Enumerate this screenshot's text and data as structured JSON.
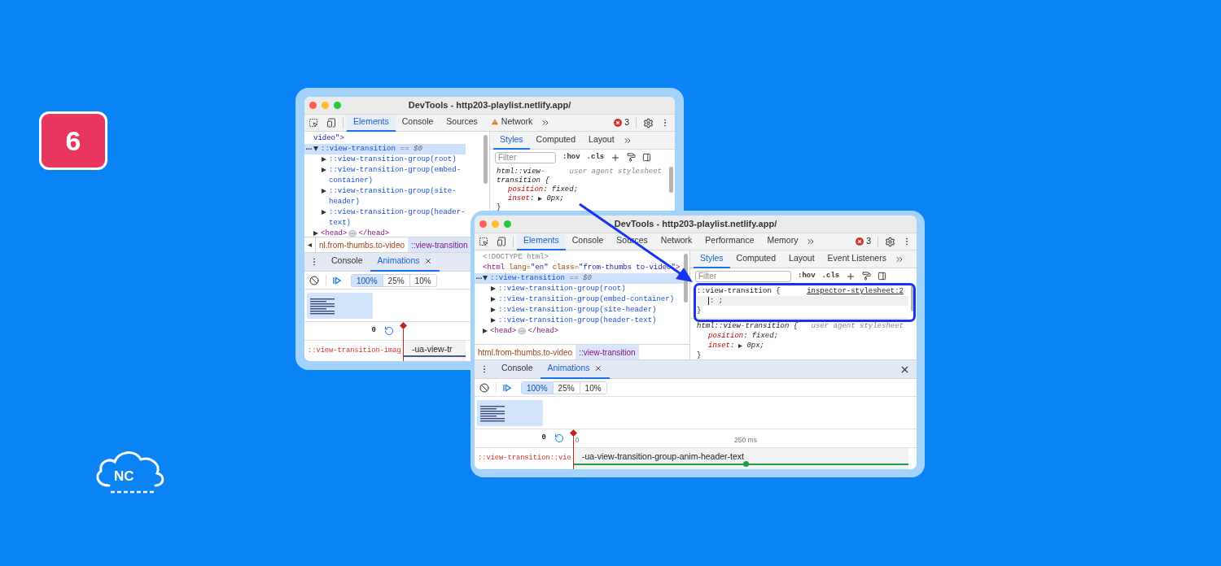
{
  "slide_badge": "6",
  "logo_text": "NC",
  "windows": [
    {
      "title": "DevTools - http203-playlist.netlify.app/",
      "toolbar_tabs": [
        {
          "label": "Elements",
          "selected": true,
          "warning": false
        },
        {
          "label": "Console",
          "selected": false,
          "warning": false
        },
        {
          "label": "Sources",
          "selected": false,
          "warning": false
        },
        {
          "label": "Network",
          "selected": false,
          "warning": true
        }
      ],
      "error_count": "3",
      "dom_tree": [
        {
          "parts": [
            {
              "kind": "value",
              "text": "video\""
            },
            {
              "kind": "tag",
              "text": ">"
            }
          ],
          "selected": false,
          "children": [
            {
              "parts": [
                {
                  "kind": "pseudo",
                  "text": "::view-transition"
                },
                {
                  "kind": "hint",
                  "text": "== $0"
                }
              ],
              "selected": true,
              "expanded": true,
              "children": [
                {
                  "parts": [
                    {
                      "kind": "pseudo",
                      "text": "::view-transition-group(root)"
                    }
                  ],
                  "selected": false,
                  "expanded": false
                },
                {
                  "parts": [
                    {
                      "kind": "pseudo",
                      "text": "::view-transition-group(embed-container)"
                    }
                  ],
                  "selected": false,
                  "expanded": false
                },
                {
                  "parts": [
                    {
                      "kind": "pseudo",
                      "text": "::view-transition-group(site-header)"
                    }
                  ],
                  "selected": false,
                  "expanded": false
                },
                {
                  "parts": [
                    {
                      "kind": "pseudo",
                      "text": "::view-transition-group(header-text)"
                    }
                  ],
                  "selected": false,
                  "expanded": false
                }
              ]
            },
            {
              "parts": [
                {
                  "kind": "tag",
                  "text": "<head>"
                },
                {
                  "kind": "collapsed"
                },
                {
                  "kind": "tag",
                  "text": "</head>"
                }
              ],
              "selected": false,
              "expanded": false
            }
          ]
        }
      ],
      "breadcrumbs": {
        "scroll_left": true,
        "items": [
          {
            "text": "nl.from-thumbs.to-video",
            "selected": false
          },
          {
            "text": "::view-transition",
            "selected": true
          }
        ]
      },
      "styles_tabs": [
        {
          "label": "Styles",
          "selected": true
        },
        {
          "label": "Computed",
          "selected": false
        },
        {
          "label": "Layout",
          "selected": false
        }
      ],
      "filter_placeholder": "Filter",
      "style_buttons": [
        ":hov",
        ".cls"
      ],
      "style_rules": [
        {
          "selector": "html::view-transition {",
          "source": "user agent stylesheet",
          "kind": "ua",
          "declarations": [
            {
              "kind": "declaration",
              "property": "position",
              "colon": ":",
              "value": "fixed;",
              "expandable": false
            },
            {
              "kind": "declaration",
              "property": "inset",
              "colon": ":",
              "value": "0px;",
              "expandable": true
            }
          ],
          "close": "}"
        }
      ],
      "drawer_tabs": [
        {
          "label": "Console",
          "selected": false,
          "closable": false
        },
        {
          "label": "Animations",
          "selected": true,
          "closable": true
        }
      ],
      "drawer_close": false,
      "speeds": [
        {
          "label": "100%",
          "selected": true
        },
        {
          "label": "25%",
          "selected": false
        },
        {
          "label": "10%",
          "selected": false
        }
      ],
      "previews": [
        {
          "selected": true
        }
      ],
      "current_time": "0",
      "animations": [
        {
          "name": "::view-transition-imag",
          "label": "-ua-view-tr",
          "color": "#4b5c86"
        }
      ]
    },
    {
      "title": "DevTools - http203-playlist.netlify.app/",
      "toolbar_tabs": [
        {
          "label": "Elements",
          "selected": true,
          "warning": false
        },
        {
          "label": "Console",
          "selected": false,
          "warning": false
        },
        {
          "label": "Sources",
          "selected": false,
          "warning": false
        },
        {
          "label": "Network",
          "selected": false,
          "warning": false
        },
        {
          "label": "Performance",
          "selected": false,
          "warning": false
        },
        {
          "label": "Memory",
          "selected": false,
          "warning": false
        }
      ],
      "error_count": "3",
      "dom_tree": [
        {
          "parts": [
            {
              "kind": "doctype",
              "text": "<!DOCTYPE html>"
            }
          ],
          "selected": false
        },
        {
          "parts": [
            {
              "kind": "tag",
              "text": "<html"
            },
            {
              "kind": "attr",
              "text": "lang="
            },
            {
              "kind": "value",
              "text": "\"en\""
            },
            {
              "kind": "attr",
              "text": "class="
            },
            {
              "kind": "value",
              "text": "\"from-thumbs to-video\""
            },
            {
              "kind": "tag",
              "text": ">"
            }
          ],
          "selected": false,
          "children": [
            {
              "parts": [
                {
                  "kind": "pseudo",
                  "text": "::view-transition"
                },
                {
                  "kind": "hint",
                  "text": "== $0"
                }
              ],
              "selected": true,
              "expanded": true,
              "children": [
                {
                  "parts": [
                    {
                      "kind": "pseudo",
                      "text": "::view-transition-group(root)"
                    }
                  ],
                  "selected": false,
                  "expanded": false
                },
                {
                  "parts": [
                    {
                      "kind": "pseudo",
                      "text": "::view-transition-group(embed-container)"
                    }
                  ],
                  "selected": false,
                  "expanded": false
                },
                {
                  "parts": [
                    {
                      "kind": "pseudo",
                      "text": "::view-transition-group(site-header)"
                    }
                  ],
                  "selected": false,
                  "expanded": false
                },
                {
                  "parts": [
                    {
                      "kind": "pseudo",
                      "text": "::view-transition-group(header-text)"
                    }
                  ],
                  "selected": false,
                  "expanded": false
                }
              ]
            },
            {
              "parts": [
                {
                  "kind": "tag",
                  "text": "<head>"
                },
                {
                  "kind": "collapsed"
                },
                {
                  "kind": "tag",
                  "text": "</head>"
                }
              ],
              "selected": false,
              "expanded": false
            }
          ]
        }
      ],
      "breadcrumbs": {
        "scroll_left": false,
        "items": [
          {
            "text": "html.from-thumbs.to-video",
            "selected": false
          },
          {
            "text": "::view-transition",
            "selected": true
          }
        ]
      },
      "styles_tabs": [
        {
          "label": "Styles",
          "selected": true
        },
        {
          "label": "Computed",
          "selected": false
        },
        {
          "label": "Layout",
          "selected": false
        },
        {
          "label": "Event Listeners",
          "selected": false
        }
      ],
      "filter_placeholder": "Filter",
      "style_buttons": [
        ":hov",
        ".cls"
      ],
      "style_rules": [
        {
          "selector": "::view-transition {",
          "source": "inspector-stylesheet:2",
          "kind": "link",
          "declarations": [
            {
              "kind": "editor",
              "text": ": ;"
            }
          ],
          "close": "}"
        },
        {
          "selector": "html::view-transition {",
          "source": "user agent stylesheet",
          "kind": "ua",
          "declarations": [
            {
              "kind": "declaration",
              "property": "position",
              "colon": ":",
              "value": "fixed;",
              "expandable": false
            },
            {
              "kind": "declaration",
              "property": "inset",
              "colon": ":",
              "value": "0px;",
              "expandable": true
            }
          ],
          "close": "}"
        }
      ],
      "drawer_tabs": [
        {
          "label": "Console",
          "selected": false,
          "closable": false
        },
        {
          "label": "Animations",
          "selected": true,
          "closable": true
        }
      ],
      "drawer_close": true,
      "speeds": [
        {
          "label": "100%",
          "selected": true
        },
        {
          "label": "25%",
          "selected": false
        },
        {
          "label": "10%",
          "selected": false
        }
      ],
      "previews": [
        {
          "selected": true
        }
      ],
      "current_time": "0",
      "ticks": [
        {
          "label": "0"
        },
        {
          "label": "250 ms"
        }
      ],
      "animations": [
        {
          "name": "::view-transition::vie",
          "label": "-ua-view-transition-group-anim-header-text",
          "color": "#1e9e4a"
        }
      ]
    }
  ]
}
